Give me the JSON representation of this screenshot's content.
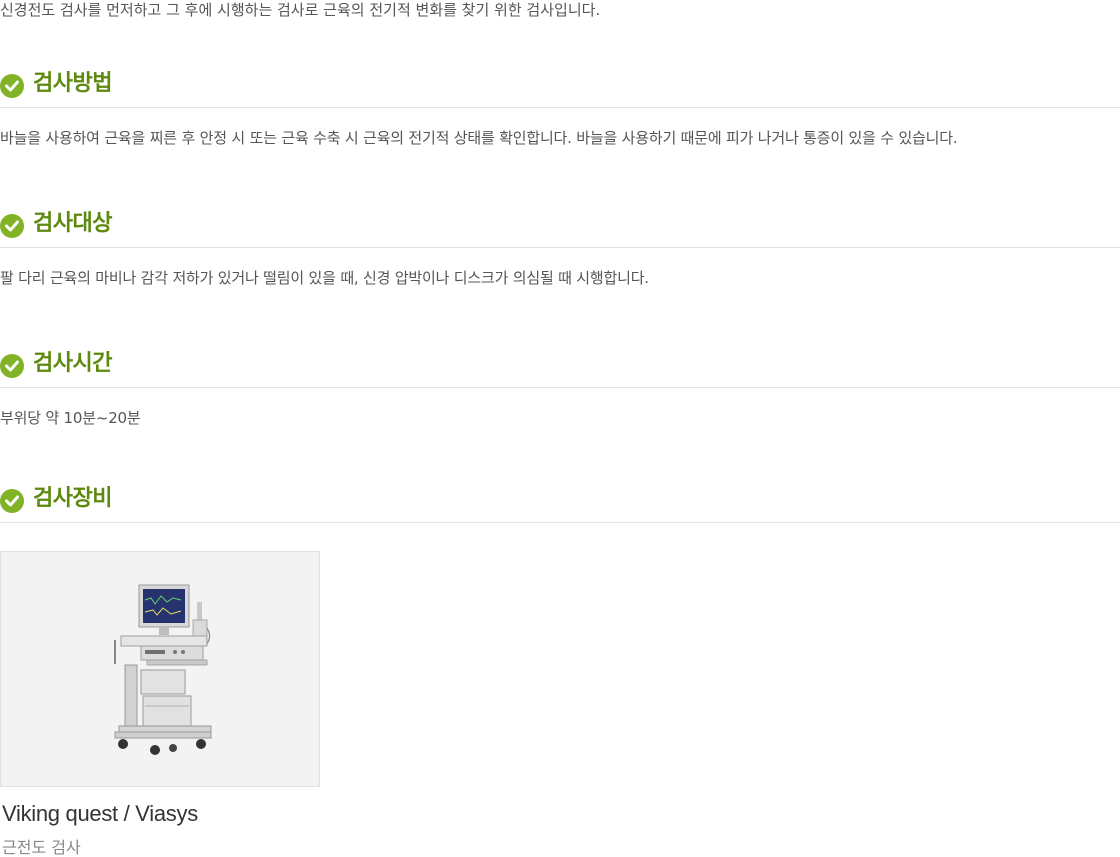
{
  "intro": "신경전도 검사를 먼저하고 그 후에 시행하는 검사로 근육의 전기적 변화를 찾기 위한 검사입니다.",
  "sections": [
    {
      "title": "검사방법",
      "body": "바늘을 사용하여 근육을 찌른 후 안정 시 또는 근육 수축 시 근육의 전기적 상태를 확인합니다. 바늘을 사용하기 때문에 피가 나거나 통증이 있을 수 있습니다."
    },
    {
      "title": "검사대상",
      "body": "팔 다리 근육의 마비나 감각 저하가 있거나 떨림이 있을 때, 신경 압박이나 디스크가 의심될 때 시행합니다."
    },
    {
      "title": "검사시간",
      "body": "부위당 약 10분~20분"
    },
    {
      "title": "검사장비"
    }
  ],
  "equipment": {
    "name": "Viking quest / Viasys",
    "description": "근전도 검사"
  },
  "colors": {
    "accent": "#82b226",
    "heading": "#5d8a0e"
  }
}
